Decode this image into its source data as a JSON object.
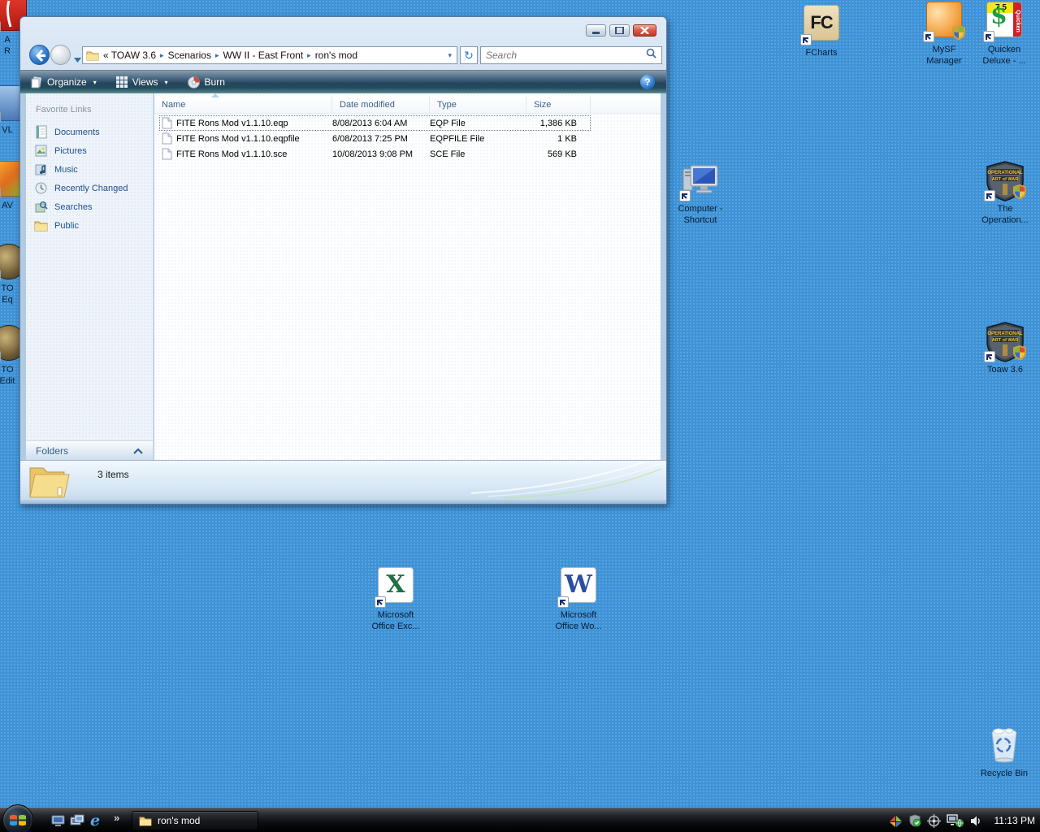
{
  "colors": {
    "desktop_blue": "#3e92d6",
    "window_frame_blue": "#b2cbe3",
    "command_bar_dark": "#27455c",
    "close_button_red": "#c2412b",
    "sidebar_link_blue": "#1f4f91",
    "taskbar_black": "#0b0d10"
  },
  "icons": {
    "search-icon": "magnifier",
    "refresh-icon": "circular-arrows",
    "help-icon": "?",
    "organize-icon": "stacked-pages",
    "views-icon": "grid-dots",
    "burn-icon": "optical-disc",
    "breadcrumb-separator": "▸",
    "dropdown-arrow": "▾",
    "chevron-up": "⌃",
    "quick-launch-overflow": "»"
  },
  "explorer": {
    "breadcrumb": {
      "overflow_chevron": "«",
      "items": [
        "TOAW 3.6",
        "Scenarios",
        "WW II - East Front",
        "ron's mod"
      ],
      "separator": "▸",
      "dropdown": "▾"
    },
    "search": {
      "placeholder": "Search"
    },
    "toolbar": {
      "organize": "Organize",
      "views": "Views",
      "burn": "Burn",
      "help_glyph": "?",
      "dropdown": "▾"
    },
    "sidebar": {
      "title": "Favorite Links",
      "items": [
        {
          "label": "Documents"
        },
        {
          "label": "Pictures"
        },
        {
          "label": "Music"
        },
        {
          "label": "Recently Changed"
        },
        {
          "label": "Searches"
        },
        {
          "label": "Public"
        }
      ],
      "folders": "Folders",
      "folders_chevron": "⌃"
    },
    "list": {
      "columns": [
        "Name",
        "Date modified",
        "Type",
        "Size"
      ],
      "rows": [
        {
          "name": "FITE Rons Mod v1.1.10.eqp",
          "date_modified": "8/08/2013 6:04 AM",
          "type": "EQP File",
          "size": "1,386 KB",
          "selected": true
        },
        {
          "name": "FITE Rons Mod v1.1.10.eqpfile",
          "date_modified": "6/08/2013 7:25 PM",
          "type": "EQPFILE File",
          "size": "1 KB",
          "selected": false
        },
        {
          "name": "FITE Rons Mod v1.1.10.sce",
          "date_modified": "10/08/2013 9:08 PM",
          "type": "SCE File",
          "size": "569 KB",
          "selected": false
        }
      ]
    },
    "statusbar": {
      "items_count": "3 items"
    }
  },
  "desktop_icons": {
    "fcharts": {
      "label": "FCharts",
      "glyph": "FC"
    },
    "mysf_manager": {
      "label_line1": "MySF",
      "label_line2": "Manager"
    },
    "quicken": {
      "label_line1": "Quicken",
      "label_line2": "Deluxe - ...",
      "badge_version": "7.5",
      "badge_dollar": "$",
      "brand_vertical": "Quicken"
    },
    "computer_shortcut": {
      "label_line1": "Computer -",
      "label_line2": "Shortcut"
    },
    "the_operational": {
      "label_line1": "The",
      "label_line2": "Operation..."
    },
    "toaw_36": {
      "label": "Toaw 3.6"
    },
    "excel": {
      "label_line1": "Microsoft",
      "label_line2": "Office Exc...",
      "glyph": "X"
    },
    "word": {
      "label_line1": "Microsoft",
      "label_line2": "Office Wo...",
      "glyph": "W"
    },
    "recycle_bin": {
      "label": "Recycle Bin"
    },
    "left_edge_partials": [
      {
        "label_line1": "A",
        "label_line2": "R"
      },
      {
        "label_line1": "VL",
        "label_line2": ""
      },
      {
        "label_line1": "AV",
        "label_line2": ""
      },
      {
        "label_line1": "TO",
        "label_line2": "Eq"
      },
      {
        "label_line1": "TO",
        "label_line2": "Edit"
      }
    ]
  },
  "taskbar": {
    "task_button": {
      "label": "ron's mod"
    },
    "quick_launch_overflow": "»",
    "clock": "11:13 PM"
  }
}
